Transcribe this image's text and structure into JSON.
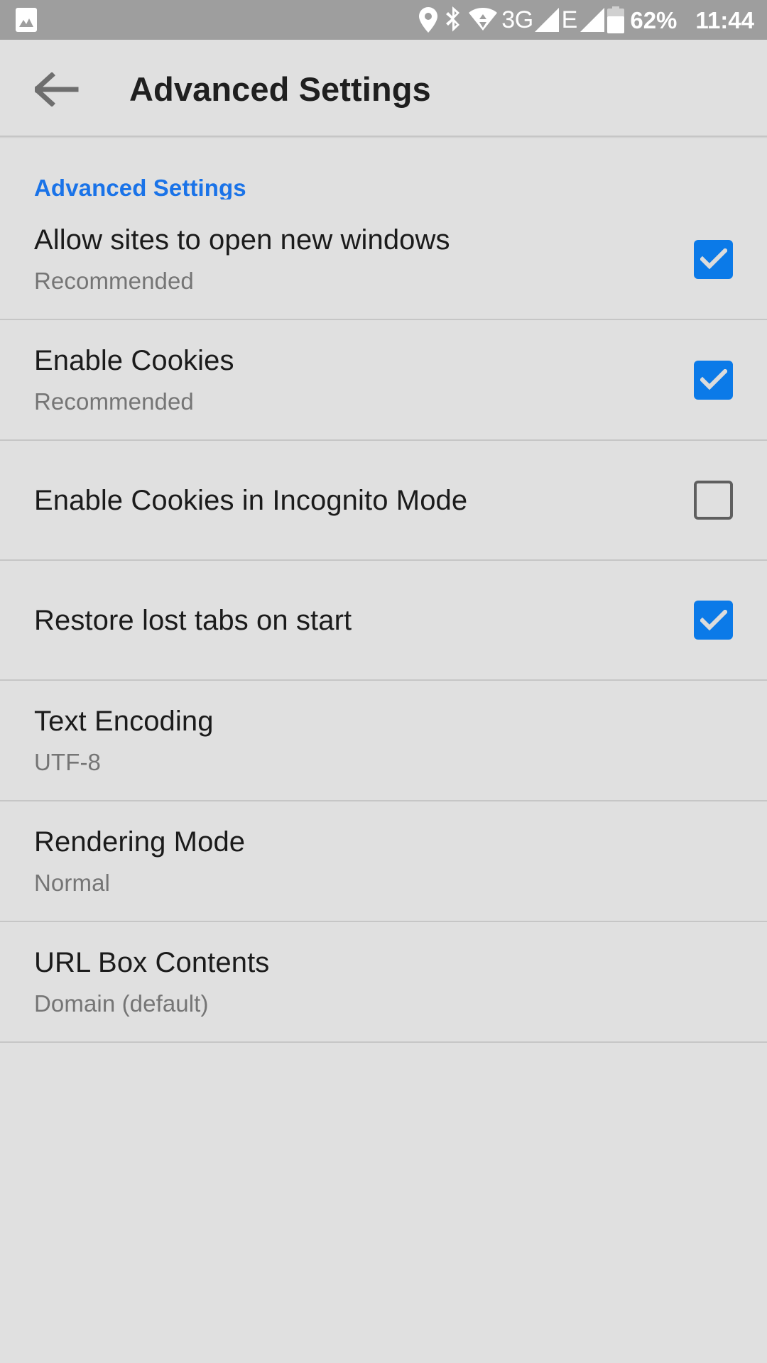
{
  "status_bar": {
    "background": "#9e9e9e",
    "left_icons": [
      {
        "name": "image-icon",
        "label": "image"
      }
    ],
    "right_icons": [
      {
        "name": "location-icon",
        "label": "location"
      },
      {
        "name": "bluetooth-icon",
        "label": "bluetooth"
      },
      {
        "name": "wifi-icon",
        "label": "wifi"
      }
    ],
    "network_type": "3G",
    "network_type_2": "E",
    "battery_percent": "62%",
    "clock": "11:44"
  },
  "app_bar": {
    "back_label": "Back",
    "title": "Advanced Settings",
    "background": "#e0e0e0",
    "title_color": "#1f1f1f"
  },
  "section": {
    "header": "Advanced Settings",
    "header_color": "#1a73e8"
  },
  "colors": {
    "checkbox_on": "#0b7ae8",
    "checkbox_off_border": "#5f5f5f",
    "divider": "#c6c6c6",
    "page_background": "#e0e0e0",
    "title_text": "#1b1b1b",
    "subtitle_text": "#757575"
  },
  "settings_rows": [
    {
      "title": "Allow sites to open new windows",
      "subtitle": "Recommended",
      "control": "checkbox",
      "checked": true,
      "name": "allow-sites-open-new-windows"
    },
    {
      "title": "Enable Cookies",
      "subtitle": "Recommended",
      "control": "checkbox",
      "checked": true,
      "name": "enable-cookies"
    },
    {
      "title": "Enable Cookies in Incognito Mode",
      "subtitle": "",
      "control": "checkbox",
      "checked": false,
      "name": "enable-cookies-incognito"
    },
    {
      "title": "Restore lost tabs on start",
      "subtitle": "",
      "control": "checkbox",
      "checked": true,
      "name": "restore-lost-tabs"
    },
    {
      "title": "Text Encoding",
      "subtitle": "UTF-8",
      "control": "none",
      "checked": false,
      "name": "text-encoding"
    },
    {
      "title": "Rendering Mode",
      "subtitle": "Normal",
      "control": "none",
      "checked": false,
      "name": "rendering-mode"
    },
    {
      "title": "URL Box Contents",
      "subtitle": "Domain (default)",
      "control": "none",
      "checked": false,
      "name": "url-box-contents"
    }
  ]
}
